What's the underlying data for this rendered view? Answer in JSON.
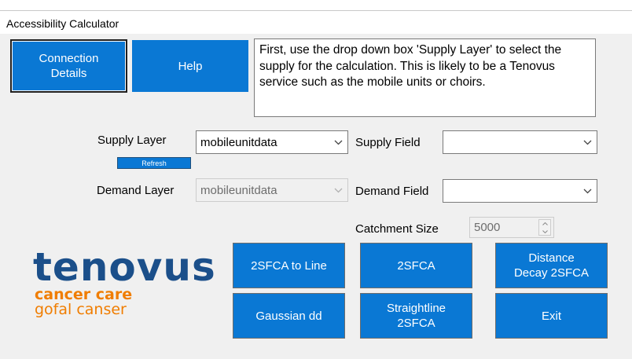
{
  "window": {
    "title": "Accessibility Calculator"
  },
  "buttons": {
    "connection_details": "Connection\nDetails",
    "help": "Help",
    "refresh": "Refresh",
    "twosfca_to_line": "2SFCA to Line",
    "twosfca": "2SFCA",
    "distance_decay": "Distance\nDecay 2SFCA",
    "gaussian_dd": "Gaussian dd",
    "straightline": "Straightline\n2SFCA",
    "exit": "Exit"
  },
  "info_text": "First, use the drop down box 'Supply Layer' to select the supply for the calculation. This is likely to be a Tenovus service such as the mobile units or choirs.",
  "form": {
    "supply_layer_label": "Supply Layer",
    "supply_layer_value": "mobileunitdata",
    "supply_field_label": "Supply Field",
    "supply_field_value": "",
    "demand_layer_label": "Demand Layer",
    "demand_layer_value": "mobileunitdata",
    "demand_field_label": "Demand Field",
    "demand_field_value": "",
    "catchment_label": "Catchment Size",
    "catchment_value": "5000"
  },
  "logo": {
    "main": "tenovus",
    "line2": "cancer care",
    "line3": "gofal canser"
  },
  "colors": {
    "button_blue": "#0a78d4",
    "logo_blue": "#1b4f8a",
    "logo_orange": "#f07d00"
  }
}
